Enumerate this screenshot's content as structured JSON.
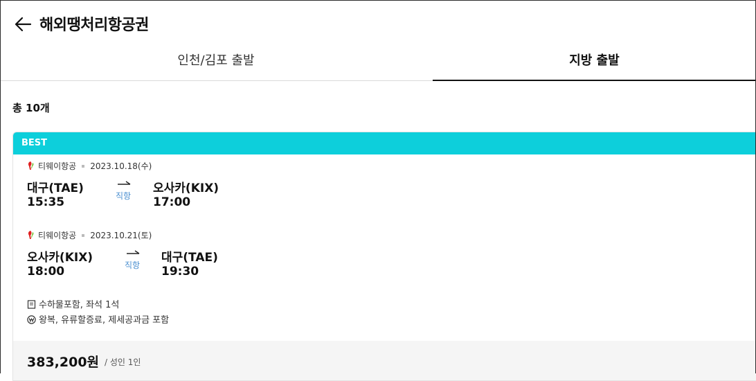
{
  "header": {
    "title": "해외땡처리항공권",
    "back_icon": "arrow-left-icon"
  },
  "tabs": [
    {
      "label": "인천/김포 출발",
      "active": false
    },
    {
      "label": "지방 출발",
      "active": true
    }
  ],
  "result_count": "총 10개",
  "card": {
    "badge": "BEST",
    "badge_color": "#0dcfdb",
    "legs": [
      {
        "airline": "티웨이항공",
        "date": "2023.10.18(수)",
        "from_city": "대구(TAE)",
        "from_time": "15:35",
        "to_city": "오사카(KIX)",
        "to_time": "17:00",
        "route_type": "직항"
      },
      {
        "airline": "티웨이항공",
        "date": "2023.10.21(토)",
        "from_city": "오사카(KIX)",
        "from_time": "18:00",
        "to_city": "대구(TAE)",
        "to_time": "19:30",
        "route_type": "직항"
      }
    ],
    "notes": [
      {
        "icon": "document-icon",
        "text": "수하물포함, 좌석 1석"
      },
      {
        "icon": "won-icon",
        "text": "왕복, 유류할증료, 제세공과금 포함"
      }
    ],
    "price": "383,200원",
    "price_unit": "/ 성인 1인"
  }
}
